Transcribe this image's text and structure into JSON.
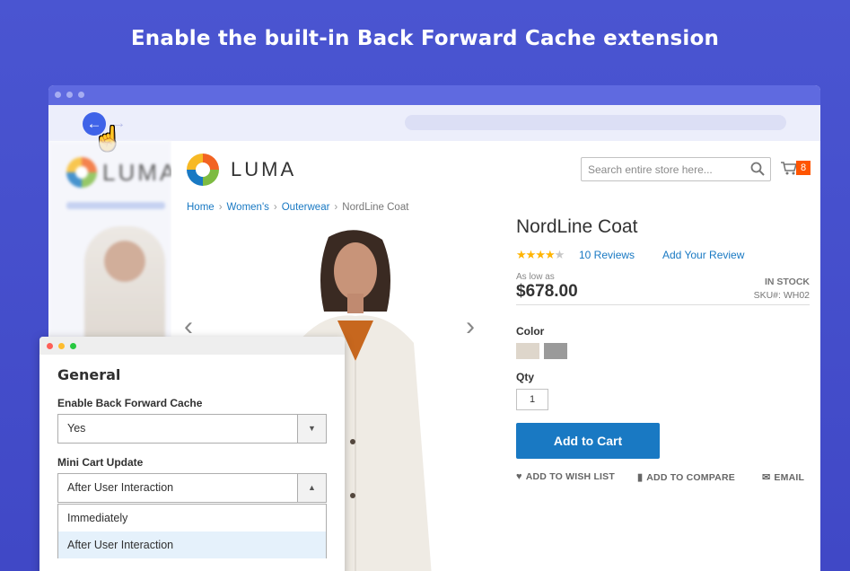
{
  "headline": "Enable the built-in Back Forward Cache extension",
  "browser": {
    "back_icon": "arrow-left-icon",
    "forward_icon": "arrow-right-icon",
    "cursor_icon": "hand-pointer-icon",
    "ghost_logo_text": "LUMA",
    "ghost_crumbs": "Home > Women's > Outerwear"
  },
  "store": {
    "logo_text": "LUMA",
    "search_placeholder": "Search entire store here...",
    "cart_count": "8",
    "breadcrumbs": {
      "home": "Home",
      "women": "Women's",
      "outerwear": "Outerwear",
      "current": "NordLine Coat"
    },
    "product": {
      "title": "NordLine Coat",
      "rating": 4,
      "rating_max": 5,
      "reviews": "10 Reviews",
      "add_review": "Add Your Review",
      "as_low_as": "As low as",
      "price": "$678.00",
      "stock": "IN STOCK",
      "sku": "SKU#: WH02",
      "color_label": "Color",
      "swatches": [
        "#ded6cb",
        "#9a9a9a"
      ],
      "qty_label": "Qty",
      "qty_value": "1",
      "add_to_cart": "Add to Cart",
      "actions": {
        "wishlist": "ADD TO WISH LIST",
        "compare": "ADD TO COMPARE",
        "email": "EMAIL"
      }
    }
  },
  "settings": {
    "heading": "General",
    "bfcache_label": "Enable Back Forward Cache",
    "bfcache_value": "Yes",
    "minicart_label": "Mini Cart Update",
    "minicart_value": "After User Interaction",
    "options": [
      "Immediately",
      "After User Interaction"
    ]
  },
  "colors": {
    "background": "#4a55d1",
    "accent": "#1979c3",
    "cart_badge": "#ff5501",
    "star": "#ffb400"
  }
}
